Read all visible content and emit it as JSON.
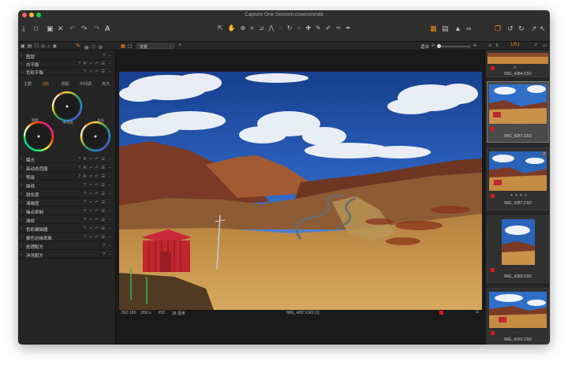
{
  "window": {
    "title": "Capture One Session.cosessiondb"
  },
  "secbar": {
    "selector_value": "背景",
    "fit_label": "适合",
    "counter": "1/61"
  },
  "left_panel": {
    "top_tools": [
      {
        "label": "图层",
        "actions": "? ⋯"
      },
      {
        "label": "白平衡",
        "actions": "? A ↗ ↶ ☰ ⋯"
      },
      {
        "label": "色彩平衡",
        "actions": "? ↗ ↶ ☰ ⋯"
      }
    ],
    "color_tabs": [
      "主要",
      "3向",
      "阴影",
      "中间调",
      "高光"
    ],
    "active_tab_index": 1,
    "wheel_labels": {
      "midtones": "中间调",
      "shadows": "阴影",
      "highlights": "高光"
    },
    "tools": [
      {
        "label": "曝光",
        "actions": "? A ↗ ↶ ☰ ⋯"
      },
      {
        "label": "高动态范围",
        "actions": "? A ↗ ↶ ☰ ⋯"
      },
      {
        "label": "等级",
        "actions": "? A ↗ ↶ ☰ ⋯"
      },
      {
        "label": "曲线",
        "actions": "? ↗ ↶ ☰ ⋯"
      },
      {
        "label": "锐化度",
        "actions": "? ↗ ↶ ☰ ⋯"
      },
      {
        "label": "清晰度",
        "actions": "? ↗ ↶ ☰ ⋯"
      },
      {
        "label": "噪点抑制",
        "actions": "? ↗ ↶ ☰ ⋯"
      },
      {
        "label": "波纹",
        "actions": "? ↗ ↶ ☰ ⋯"
      },
      {
        "label": "色彩编辑器",
        "actions": "? ↗ ↶ ☰ ⋯"
      },
      {
        "label": "紫色边缘现象",
        "actions": "? ↗ ↶ ☰ ⋯"
      },
      {
        "label": "处理配方",
        "actions": "? ⋯"
      },
      {
        "label": "冲洗配方",
        "actions": "? ⋯"
      }
    ]
  },
  "viewer": {
    "iso": "ISO 100",
    "shutter": "1/50 s",
    "aperture": "f/22",
    "focal": "28 毫米",
    "filename": "IMG_4287.CR2 [1]"
  },
  "browser": {
    "thumbnails": [
      {
        "name": "IMG_4284.CR2",
        "selected": false
      },
      {
        "name": "IMG_4287.CR2",
        "selected": true
      },
      {
        "name": "IMG_4287.CR2",
        "selected": false,
        "badge": "2"
      },
      {
        "name": "IMG_4289.CR2",
        "selected": false
      },
      {
        "name": "IMG_4292.CR2",
        "selected": false
      }
    ]
  },
  "colors": {
    "accent": "#f08a1a",
    "color_tag": "#d11b1b",
    "window_bg": "#1d1d1d"
  },
  "icons": [
    "import-icon",
    "camera-icon",
    "export-icon",
    "delete-icon",
    "undo-icon",
    "redo-icon",
    "text-icon",
    "cursor-tools-icon",
    "crop-icon",
    "grid-icon",
    "warning-icon",
    "glasses-icon",
    "rotate-left-icon",
    "rotate-right-icon",
    "search-icon"
  ]
}
